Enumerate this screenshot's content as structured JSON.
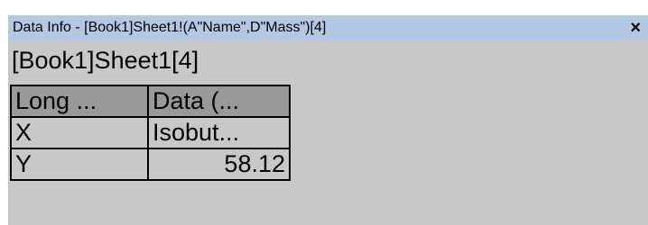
{
  "window": {
    "title": "Data Info - [Book1]Sheet1!(A\"Name\",D\"Mass\")[4]",
    "close_glyph": "×"
  },
  "subtitle": "[Book1]Sheet1[4]",
  "table": {
    "headers": [
      "Long ...",
      "Data (..."
    ],
    "rows": [
      [
        "X",
        "Isobut..."
      ],
      [
        "Y",
        "58.12"
      ]
    ]
  },
  "colors": {
    "titlebar": "#b3c9e3",
    "panel": "#c8c8c8",
    "header_cell": "#999999"
  }
}
